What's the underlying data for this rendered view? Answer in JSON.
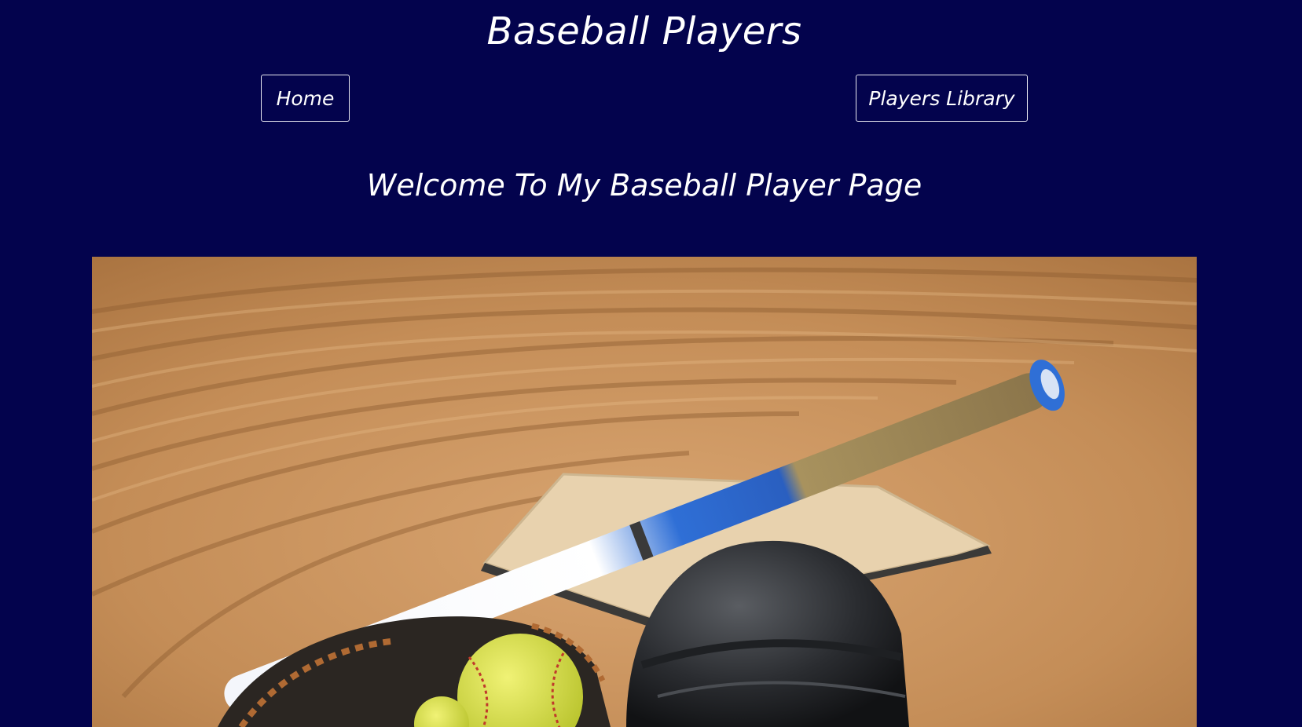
{
  "header": {
    "title": "Baseball Players"
  },
  "nav": {
    "home_label": "Home",
    "library_label": "Players Library"
  },
  "main": {
    "welcome": "Welcome To My Baseball Player Page",
    "hero_image": "baseball-equipment-on-home-plate"
  },
  "colors": {
    "background": "#03034d",
    "text": "#ffffff",
    "dirt": "#c4915f",
    "bat_blue": "#2f6fd6"
  }
}
